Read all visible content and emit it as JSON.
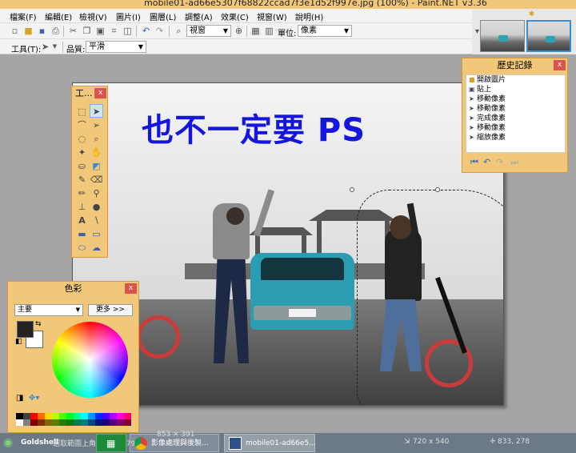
{
  "window": {
    "title": "mobile01-ad66e5307f68822ccad7f3e1d52f997e.jpg (100%) - Paint.NET v3.36"
  },
  "menu": [
    "檔案(F)",
    "編輯(E)",
    "檢視(V)",
    "圖片(I)",
    "圖層(L)",
    "調整(A)",
    "效果(C)",
    "視窗(W)",
    "說明(H)"
  ],
  "toolbar": {
    "zoom_value": "視窗",
    "units_label": "單位:",
    "units_value": "像素",
    "tool_label": "工具(T):",
    "quality_label": "品質:",
    "quality_value": "平滑"
  },
  "canvas": {
    "overlay_text": "也不一定要 PS"
  },
  "tools_panel": {
    "title": "工...",
    "close": "x"
  },
  "history_panel": {
    "title": "歷史記錄",
    "close": "x",
    "items": [
      "開啟圖片",
      "貼上",
      "移動像素",
      "移動像素",
      "完成像素",
      "移動像素",
      "縮放像素"
    ]
  },
  "colors_panel": {
    "title": "色彩",
    "close": "x",
    "mode": "主要",
    "more_button": "更多 >>",
    "primary_color": "#222222",
    "secondary_color": "#ffffff"
  },
  "taskbar": {
    "start_label": "Goldshell",
    "chrome_label": "影像處理與後製...",
    "paintnet_label": "mobile01-ad66e5...",
    "status_left": "選取範圍上角: 467，179",
    "status_mid": "853 × 391",
    "image_size": "720 x 540",
    "cursor_pos": "833, 278"
  }
}
